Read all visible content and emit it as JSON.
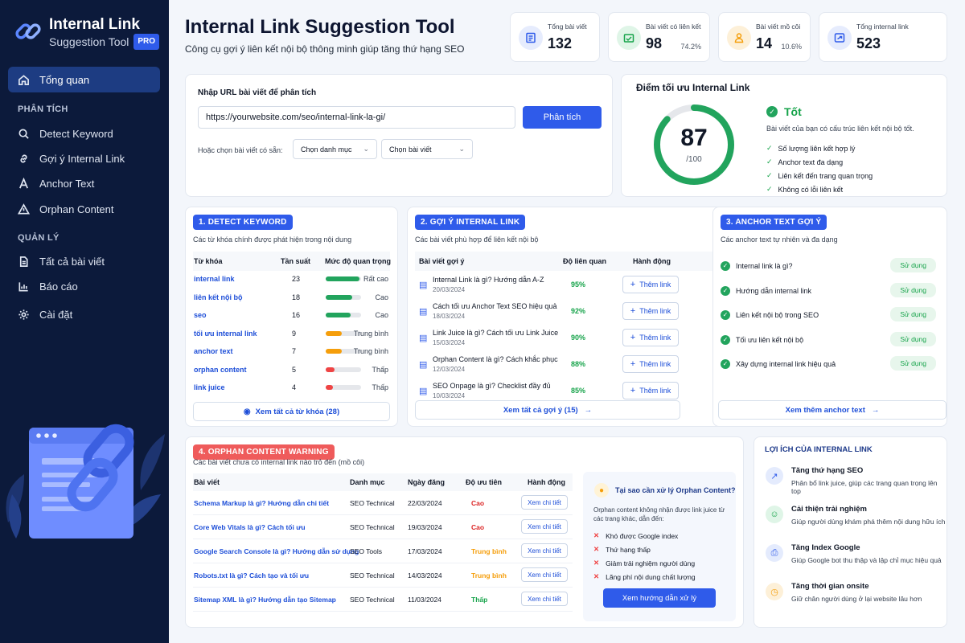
{
  "brand": {
    "title": "Internal Link",
    "subtitle": "Suggestion Tool",
    "badge": "PRO"
  },
  "nav": {
    "overview": "Tổng quan",
    "section_analysis": "PHÂN TÍCH",
    "detect_keyword": "Detect Keyword",
    "suggest_link": "Gợi ý Internal Link",
    "anchor_text": "Anchor Text",
    "orphan_content": "Orphan Content",
    "section_manage": "QUẢN LÝ",
    "all_posts": "Tất cả bài viết",
    "reports": "Báo cáo",
    "settings": "Cài đặt"
  },
  "header": {
    "title": "Internal Link Suggestion Tool",
    "subtitle": "Công cụ gợi ý liên kết nội bộ thông minh giúp tăng thứ hạng SEO"
  },
  "stats": [
    {
      "label": "Tổng bài viết",
      "value": "132",
      "pct": ""
    },
    {
      "label": "Bài viết có liên kết",
      "value": "98",
      "pct": "74.2%"
    },
    {
      "label": "Bài viết mồ côi",
      "value": "14",
      "pct": "10.6%"
    },
    {
      "label": "Tổng internal link",
      "value": "523",
      "pct": ""
    }
  ],
  "url_box": {
    "label": "Nhập URL bài viết để phân tích",
    "value": "https://yourwebsite.com/seo/internal-link-la-gi/",
    "button": "Phân tích",
    "or_label": "Hoặc chọn bài viết có sẵn:",
    "select_category": "Chọn danh mục",
    "select_post": "Chọn bài viết"
  },
  "score": {
    "title": "Điểm tối ưu Internal Link",
    "value": 87,
    "max_label": "/100",
    "max": 100,
    "status": "Tốt",
    "desc": "Bài viết của bạn có cấu trúc liên kết nội bộ tốt.",
    "checks": [
      "Số lượng liên kết hợp lý",
      "Anchor text đa dạng",
      "Liên kết đến trang quan trọng",
      "Không có lỗi liên kết"
    ]
  },
  "keywords": {
    "badge": "1. DETECT KEYWORD",
    "desc": "Các từ khóa chính được phát hiện trong nội dung",
    "headers": [
      "Từ khóa",
      "Tần suất",
      "Mức độ quan trọng"
    ],
    "rows": [
      {
        "kw": "internal link",
        "freq": "23",
        "level": "Rất cao",
        "fill": 0.95,
        "color": "#22a45d"
      },
      {
        "kw": "liên kết nội bộ",
        "freq": "18",
        "level": "Cao",
        "fill": 0.75,
        "color": "#22a45d"
      },
      {
        "kw": "seo",
        "freq": "16",
        "level": "Cao",
        "fill": 0.7,
        "color": "#22a45d"
      },
      {
        "kw": "tối ưu internal link",
        "freq": "9",
        "level": "Trung bình",
        "fill": 0.45,
        "color": "#f59e0b"
      },
      {
        "kw": "anchor text",
        "freq": "7",
        "level": "Trung bình",
        "fill": 0.45,
        "color": "#f59e0b"
      },
      {
        "kw": "orphan content",
        "freq": "5",
        "level": "Thấp",
        "fill": 0.25,
        "color": "#ef4444"
      },
      {
        "kw": "link juice",
        "freq": "4",
        "level": "Thấp",
        "fill": 0.2,
        "color": "#ef4444"
      }
    ],
    "footer": "Xem tất cả từ khóa (28)"
  },
  "suggestions": {
    "badge": "2. GỢI Ý INTERNAL LINK",
    "desc": "Các bài viết phù hợp để liên kết nội bộ",
    "headers": [
      "Bài viết gợi ý",
      "Độ liên quan",
      "Hành động"
    ],
    "rows": [
      {
        "title": "Internal Link là gì? Hướng dẫn A-Z",
        "date": "20/03/2024",
        "rel": "95%"
      },
      {
        "title": "Cách tối ưu Anchor Text SEO hiệu quả",
        "date": "18/03/2024",
        "rel": "92%"
      },
      {
        "title": "Link Juice là gì? Cách tối ưu Link Juice",
        "date": "15/03/2024",
        "rel": "90%"
      },
      {
        "title": "Orphan Content là gì? Cách khắc phục",
        "date": "12/03/2024",
        "rel": "88%"
      },
      {
        "title": "SEO Onpage là gì? Checklist đầy đủ",
        "date": "10/03/2024",
        "rel": "85%"
      }
    ],
    "add_label": "Thêm link",
    "footer": "Xem tất cả gợi ý (15)"
  },
  "anchors": {
    "badge": "3. ANCHOR TEXT GỢI Ý",
    "desc": "Các anchor text tự nhiên và đa dạng",
    "rows": [
      "Internal link là gì?",
      "Hướng dẫn internal link",
      "Liên kết nội bộ trong SEO",
      "Tối ưu liên kết nội bộ",
      "Xây dựng internal link hiệu quả"
    ],
    "use_label": "Sử dụng",
    "footer": "Xem thêm anchor text"
  },
  "orphan": {
    "badge": "4. ORPHAN CONTENT WARNING",
    "desc": "Các bài viết chưa có internal link nào trỏ đến (mồ côi)",
    "headers": [
      "Bài viết",
      "Danh mục",
      "Ngày đăng",
      "Độ ưu tiên",
      "Hành động"
    ],
    "rows": [
      {
        "title": "Schema Markup là gì? Hướng dẫn chi tiết",
        "cat": "SEO Technical",
        "date": "22/03/2024",
        "prio": "Cao",
        "color": "#dc2626"
      },
      {
        "title": "Core Web Vitals là gì? Cách tối ưu",
        "cat": "SEO Technical",
        "date": "19/03/2024",
        "prio": "Cao",
        "color": "#dc2626"
      },
      {
        "title": "Google Search Console là gì? Hướng dẫn sử dụng",
        "cat": "SEO Tools",
        "date": "17/03/2024",
        "prio": "Trung bình",
        "color": "#f59e0b"
      },
      {
        "title": "Robots.txt là gì? Cách tạo và tối ưu",
        "cat": "SEO Technical",
        "date": "14/03/2024",
        "prio": "Trung bình",
        "color": "#f59e0b"
      },
      {
        "title": "Sitemap XML là gì? Hướng dẫn tạo Sitemap",
        "cat": "SEO Technical",
        "date": "11/03/2024",
        "prio": "Thấp",
        "color": "#16a34a"
      }
    ],
    "detail_label": "Xem chi tiết",
    "why_title": "Tại sao cần xử lý Orphan Content?",
    "why_desc": "Orphan content không nhận được link juice từ các trang khác, dẫn đến:",
    "why_items": [
      "Khó được Google index",
      "Thứ hạng thấp",
      "Giảm trải nghiệm người dùng",
      "Lãng phí nội dung chất lượng"
    ],
    "why_button": "Xem hướng dẫn xử lý"
  },
  "benefits": {
    "title": "LỢI ÍCH CỦA INTERNAL LINK",
    "items": [
      {
        "title": "Tăng thứ hạng SEO",
        "desc": "Phân bổ link juice, giúp các trang quan trọng lên top",
        "color": "#2f5bea",
        "bg": "#e4ebfd"
      },
      {
        "title": "Cải thiện trải nghiệm",
        "desc": "Giúp người dùng khám phá thêm nội dung hữu ích",
        "color": "#16a34a",
        "bg": "#dff5e7"
      },
      {
        "title": "Tăng Index Google",
        "desc": "Giúp Google bot thu thập và lập chỉ mục hiệu quả",
        "color": "#2f5bea",
        "bg": "#e4ebfd"
      },
      {
        "title": "Tăng thời gian onsite",
        "desc": "Giữ chân người dùng ở lại website lâu hơn",
        "color": "#f59e0b",
        "bg": "#fdf0d8"
      }
    ]
  }
}
